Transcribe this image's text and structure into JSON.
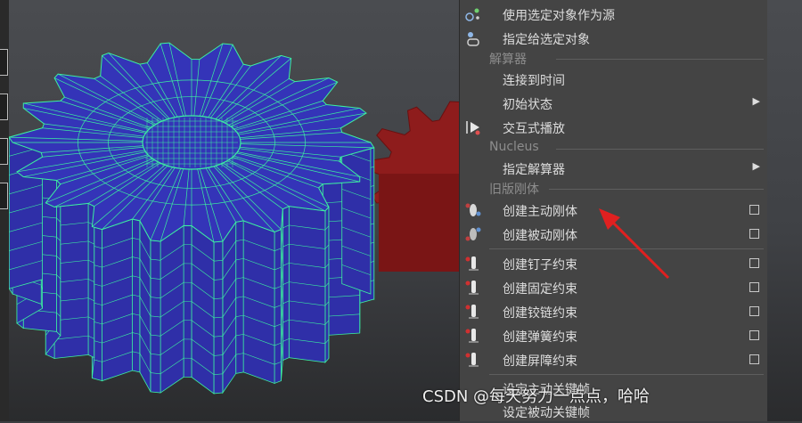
{
  "menu": {
    "items_top": [
      {
        "label": "使用选定对象作为源",
        "icon": "source-object-icon"
      },
      {
        "label": "指定给选定对象",
        "icon": "assign-object-icon"
      }
    ],
    "section_solver": {
      "title": "解算器",
      "items": [
        {
          "label": "连接到时间"
        },
        {
          "label": "初始状态",
          "submenu": true
        },
        {
          "label": "交互式播放",
          "icon": "play-icon"
        }
      ]
    },
    "section_nucleus": {
      "title": "Nucleus",
      "items": [
        {
          "label": "指定解算器",
          "submenu": true
        }
      ]
    },
    "section_legacy": {
      "title": "旧版刚体",
      "items": [
        {
          "label": "创建主动刚体",
          "icon": "active-rigid-body-icon",
          "option_box": true
        },
        {
          "label": "创建被动刚体",
          "icon": "passive-rigid-body-icon",
          "option_box": true
        }
      ],
      "constraints": [
        {
          "label": "创建钉子约束",
          "icon": "nail-constraint-icon",
          "option_box": true
        },
        {
          "label": "创建固定约束",
          "icon": "pin-constraint-icon",
          "option_box": true
        },
        {
          "label": "创建铰链约束",
          "icon": "hinge-constraint-icon",
          "option_box": true
        },
        {
          "label": "创建弹簧约束",
          "icon": "spring-constraint-icon",
          "option_box": true
        },
        {
          "label": "创建屏障约束",
          "icon": "barrier-constraint-icon",
          "option_box": true
        }
      ],
      "keys": [
        {
          "label": "设定主动关键帧"
        },
        {
          "label": "设定被动关键帧"
        }
      ]
    },
    "submenu_arrow": "▶"
  },
  "watermark": "CSDN @每天努力一点点，哈哈",
  "colors": {
    "gear_blue": "#3434b8",
    "gear_wire": "#3cf0a0",
    "gear_red": "#8e1c1c",
    "menu_bg": "#444444",
    "annotation": "#e02020"
  }
}
